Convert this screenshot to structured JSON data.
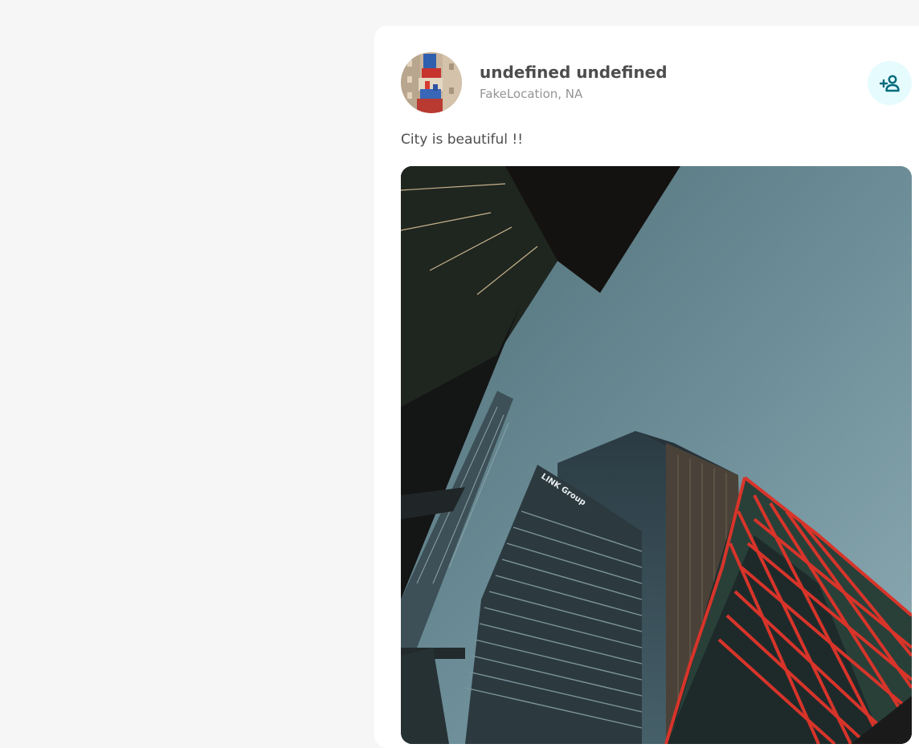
{
  "post": {
    "author": {
      "name": "undefined undefined",
      "location": "FakeLocation, NA",
      "avatar": "profile-picture"
    },
    "text": "City is beautiful !!",
    "image": {
      "subject": "skyscrapers-looking-up",
      "sign_text": "LINK Group"
    },
    "add_friend_icon": "person-add-icon",
    "colors": {
      "background": "#f6f6f6",
      "card": "#ffffff",
      "accent": "#006b7d",
      "accent_light": "#e6fbfd"
    }
  }
}
